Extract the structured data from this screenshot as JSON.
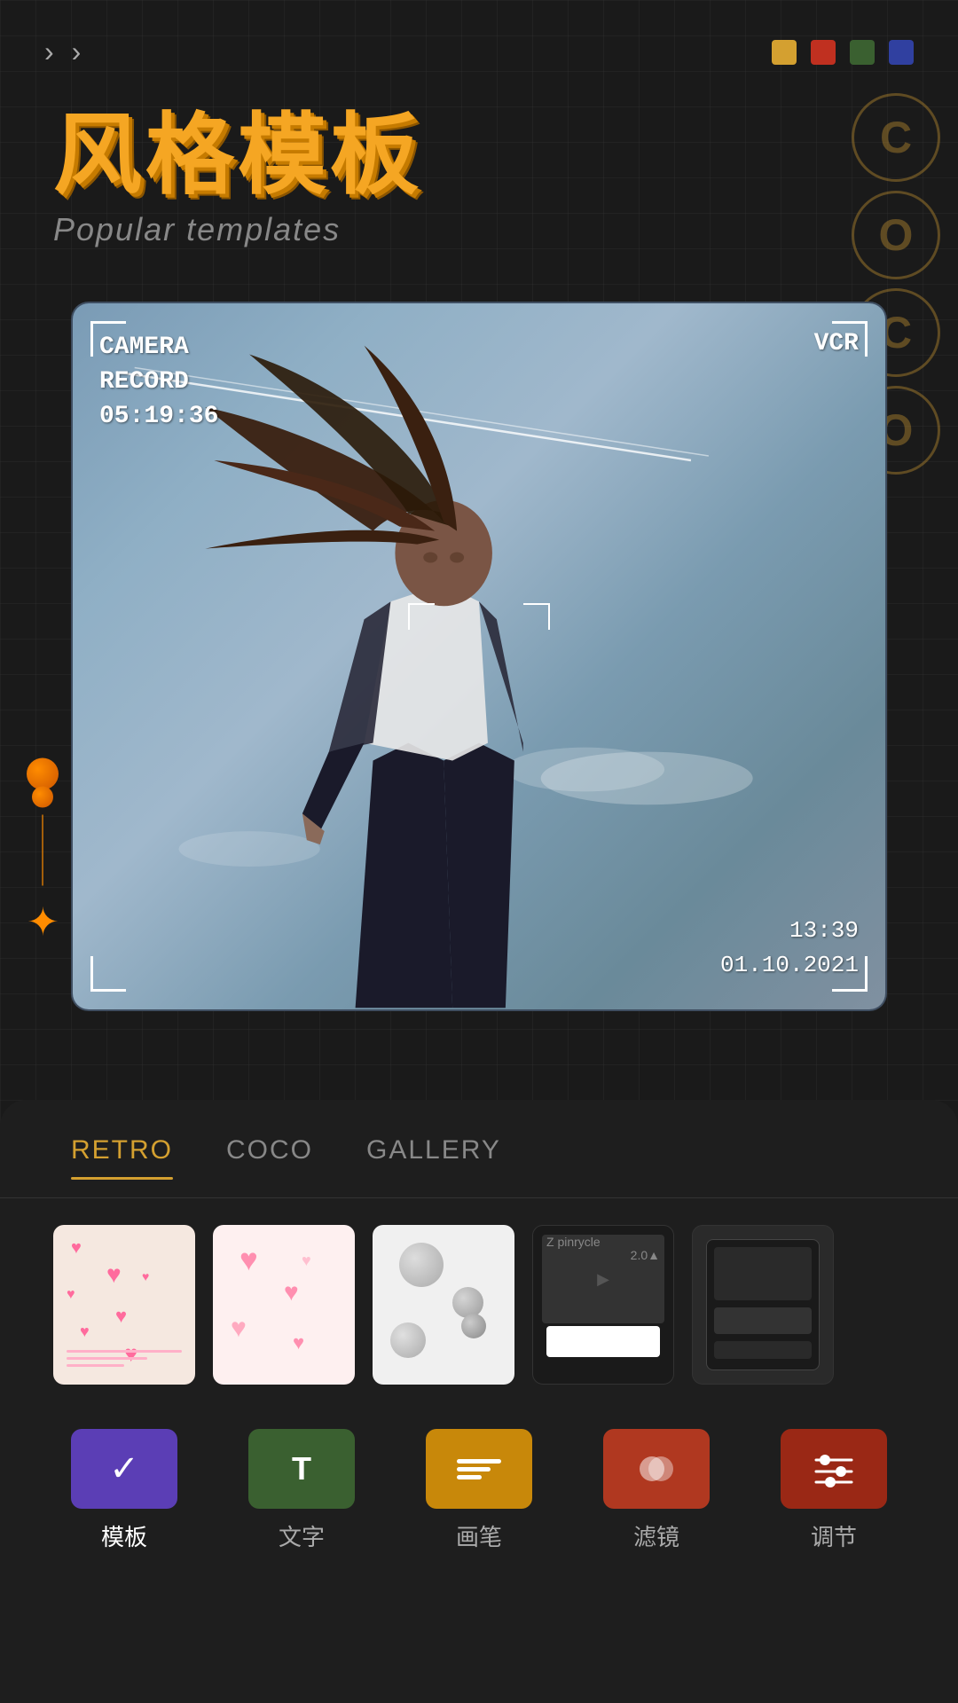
{
  "nav": {
    "arrow1": "›",
    "arrow2": "›"
  },
  "colors": {
    "dot1": "#d4a030",
    "dot2": "#c03020",
    "dot3": "#3a6030",
    "dot4": "#3040a0"
  },
  "header": {
    "title_zh": "风格模板",
    "title_en": "Popular templates"
  },
  "deco": {
    "letters": [
      "C",
      "O",
      "C",
      "O"
    ]
  },
  "vcr": {
    "top_line1": "CAMERA",
    "top_line2": "RECORD",
    "top_line3": "05:19:36",
    "top_right": "VCR",
    "bottom_time": "13:39",
    "bottom_date": "01.10.2021"
  },
  "tabs": [
    {
      "label": "RETRO",
      "active": true
    },
    {
      "label": "COCO",
      "active": false
    },
    {
      "label": "GALLERY",
      "active": false
    }
  ],
  "toolbar": [
    {
      "label": "模板",
      "color": "#5b3eb5",
      "active": true,
      "icon": "check"
    },
    {
      "label": "文字",
      "color": "#3a6030",
      "active": false,
      "icon": "text"
    },
    {
      "label": "画笔",
      "color": "#c8880a",
      "active": false,
      "icon": "brush"
    },
    {
      "label": "滤镜",
      "color": "#b03820",
      "active": false,
      "icon": "filter"
    },
    {
      "label": "调节",
      "color": "#9a2815",
      "active": false,
      "icon": "adjust"
    }
  ]
}
